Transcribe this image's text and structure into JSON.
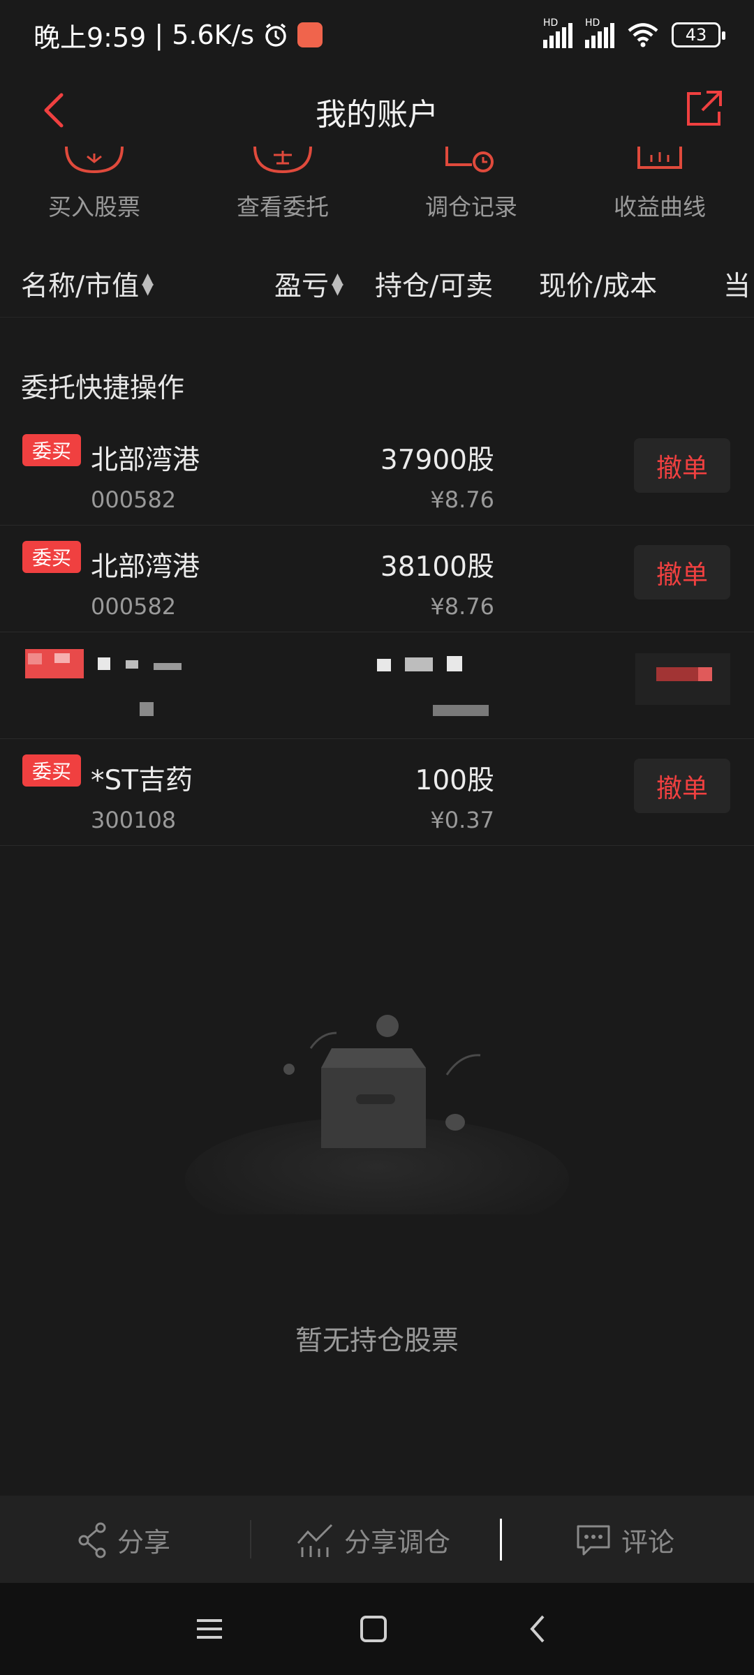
{
  "status_bar": {
    "time": "晚上9:59",
    "network_speed": "| 5.6K/s",
    "signal_1_label": "HD",
    "signal_2_label": "HD",
    "battery": "43"
  },
  "header": {
    "title": "我的账户"
  },
  "quick_actions": [
    {
      "label": "买入股票",
      "icon": "buy-icon"
    },
    {
      "label": "查看委托",
      "icon": "order-icon"
    },
    {
      "label": "调仓记录",
      "icon": "history-icon"
    },
    {
      "label": "收益曲线",
      "icon": "chart-icon"
    }
  ],
  "columns": {
    "name_value": "名称/市值",
    "profit": "盈亏",
    "holding": "持仓/可卖",
    "price_cost": "现价/成本",
    "more": "当"
  },
  "section": {
    "title": "委托快捷操作"
  },
  "orders": [
    {
      "badge": "委买",
      "name": "北部湾港",
      "code": "000582",
      "qty": "37900股",
      "price": "¥8.76",
      "action": "撤单"
    },
    {
      "badge": "委买",
      "name": "北部湾港",
      "code": "000582",
      "qty": "38100股",
      "price": "¥8.76",
      "action": "撤单"
    },
    {
      "badge": "",
      "name": "",
      "code": "",
      "qty": "",
      "price": "",
      "action": ""
    },
    {
      "badge": "委买",
      "name": "*ST吉药",
      "code": "300108",
      "qty": "100股",
      "price": "¥0.37",
      "action": "撤单"
    }
  ],
  "empty_state": {
    "text": "暂无持仓股票"
  },
  "bottom_bar": {
    "share": "分享",
    "share_rebalance": "分享调仓",
    "comment": "评论"
  },
  "colors": {
    "accent": "#f04040",
    "background": "#1a1a1a"
  }
}
